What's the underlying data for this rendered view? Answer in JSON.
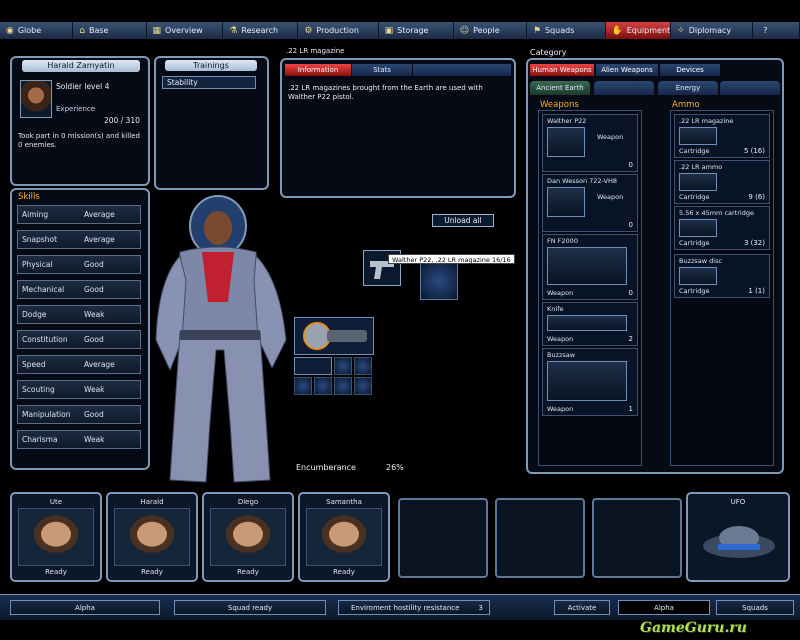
{
  "nav": [
    {
      "label": "Globe",
      "icon": "globe-icon",
      "glyph": "◉"
    },
    {
      "label": "Base",
      "icon": "base-icon",
      "glyph": "⌂"
    },
    {
      "label": "Overview",
      "icon": "overview-icon",
      "glyph": "▦"
    },
    {
      "label": "Research",
      "icon": "research-icon",
      "glyph": "⚗"
    },
    {
      "label": "Production",
      "icon": "production-icon",
      "glyph": "⚙"
    },
    {
      "label": "Storage",
      "icon": "storage-icon",
      "glyph": "▣"
    },
    {
      "label": "People",
      "icon": "people-icon",
      "glyph": "☺"
    },
    {
      "label": "Squads",
      "icon": "squads-icon",
      "glyph": "⚑"
    },
    {
      "label": "Equipment",
      "icon": "equipment-icon",
      "glyph": "✋",
      "active": true
    },
    {
      "label": "Diplomacy",
      "icon": "diplomacy-icon",
      "glyph": "✧"
    },
    {
      "label": "?",
      "icon": "help-icon",
      "glyph": ""
    }
  ],
  "soldier": {
    "name": "Harald Zamyatin",
    "rank": "Soldier level 4",
    "experience_label": "Experience",
    "experience": "200 / 310",
    "missions": "Took part in 0 mission(s) and killed 0 enemies.",
    "skills_title": "Skills",
    "skills": [
      {
        "name": "Aiming",
        "value": "Average"
      },
      {
        "name": "Snapshot",
        "value": "Average"
      },
      {
        "name": "Physical",
        "value": "Good"
      },
      {
        "name": "Mechanical",
        "value": "Good"
      },
      {
        "name": "Dodge",
        "value": "Weak"
      },
      {
        "name": "Constitution",
        "value": "Good"
      },
      {
        "name": "Speed",
        "value": "Average"
      },
      {
        "name": "Scouting",
        "value": "Weak"
      },
      {
        "name": "Manipulation",
        "value": "Good"
      },
      {
        "name": "Charisma",
        "value": "Weak"
      }
    ]
  },
  "trainings": {
    "title": "Trainings",
    "items": [
      "Stability"
    ]
  },
  "info": {
    "item_title": ".22 LR magazine",
    "tab_information": "Information",
    "tab_stats": "Stats",
    "text": ".22 LR magazines brought from the Earth are used with Walther P22 pistol."
  },
  "unload_label": "Unload all",
  "tooltip": "Walther P22, .22 LR magazine 16/16",
  "encumbrance": {
    "label": "Encumberance",
    "value": "26%"
  },
  "category": {
    "title": "Category",
    "tabs": [
      "Human Weapons",
      "Alien Weapons",
      "Devices"
    ],
    "subtabs": [
      "Ancient Earth",
      "",
      "Energy",
      ""
    ],
    "weapons_title": "Weapons",
    "ammo_title": "Ammo",
    "weapons": [
      {
        "name": "Walther P22",
        "kind": "Weapon",
        "count": "0"
      },
      {
        "name": "Dan Wesson 722-VH8",
        "kind": "Weapon",
        "count": "0"
      },
      {
        "name": "FN F2000",
        "kind": "Weapon",
        "count": "0"
      },
      {
        "name": "Knife",
        "kind": "Weapon",
        "count": "2"
      },
      {
        "name": "Buzzsaw",
        "kind": "Weapon",
        "count": "1"
      }
    ],
    "ammo": [
      {
        "name": ".22 LR magazine",
        "kind": "Cartridge",
        "count": "5 (16)"
      },
      {
        "name": ".22 LR ammo",
        "kind": "Cartridge",
        "count": "9 (6)"
      },
      {
        "name": "5.56 x 45mm cartridge",
        "kind": "Cartridge",
        "count": "3 (32)"
      },
      {
        "name": "Buzzsaw disc",
        "kind": "Cartridge",
        "count": "1 (1)"
      }
    ]
  },
  "squad": [
    {
      "name": "Ute",
      "status": "Ready"
    },
    {
      "name": "Harald",
      "status": "Ready"
    },
    {
      "name": "Diego",
      "status": "Ready"
    },
    {
      "name": "Samantha",
      "status": "Ready"
    }
  ],
  "craft": {
    "name": "UFO"
  },
  "bottom": {
    "squad_name": "Alpha",
    "squad_status": "Squad ready",
    "hostility_label": "Enviroment hostility resistance",
    "hostility_value": "3",
    "activate": "Activate",
    "active_squad": "Alpha",
    "squads": "Squads"
  },
  "watermark": "GameGuru.ru"
}
